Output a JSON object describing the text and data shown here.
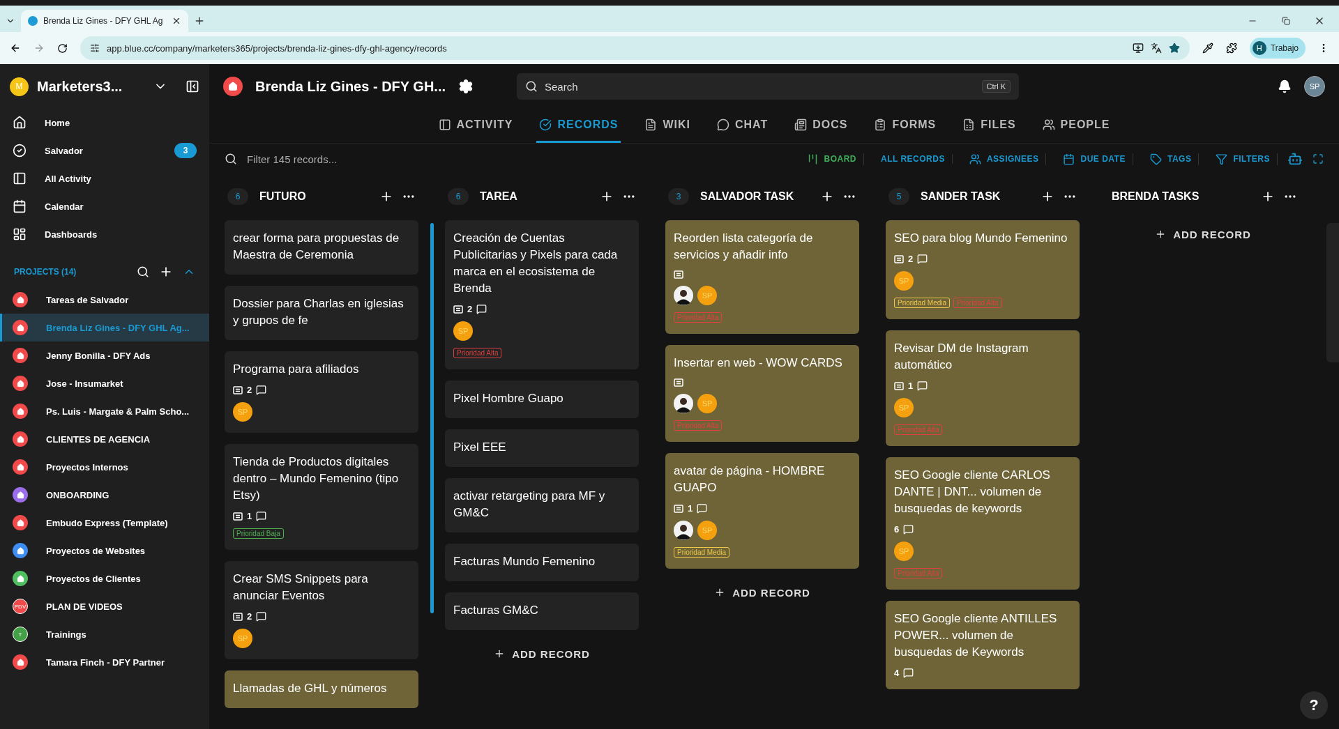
{
  "browser": {
    "tab_title": "Brenda Liz Gines - DFY GHL Ag",
    "url": "app.blue.cc/company/marketers365/projects/brenda-liz-gines-dfy-ghl-agency/records",
    "profile": {
      "initial": "H",
      "label": "Trabajo"
    }
  },
  "workspace": {
    "initial": "M",
    "name": "Marketers3..."
  },
  "nav": [
    {
      "kind": "home",
      "label": "Home"
    },
    {
      "kind": "tasks",
      "label": "Salvador",
      "badge": "3"
    },
    {
      "kind": "activity",
      "label": "All Activity"
    },
    {
      "kind": "calendar",
      "label": "Calendar"
    },
    {
      "kind": "dashboards",
      "label": "Dashboards"
    }
  ],
  "projects": {
    "title": "PROJECTS (14)",
    "expanded": true,
    "items": [
      {
        "name": "Tareas de Salvador",
        "kind": "home",
        "color": "#f04a4a",
        "selected": false
      },
      {
        "name": "Brenda Liz Gines - DFY GHL Ag...",
        "kind": "home",
        "color": "#f04a4a",
        "selected": true
      },
      {
        "name": "Jenny Bonilla - DFY Ads",
        "kind": "home",
        "color": "#f04a4a",
        "selected": false
      },
      {
        "name": "Jose - Insumarket",
        "kind": "home",
        "color": "#f04a4a",
        "selected": false
      },
      {
        "name": "Ps. Luis - Margate & Palm Scho...",
        "kind": "home",
        "color": "#f04a4a",
        "selected": false
      },
      {
        "name": "CLIENTES DE AGENCIA",
        "kind": "home",
        "color": "#f04a4a",
        "selected": false
      },
      {
        "name": "Proyectos Internos",
        "kind": "home",
        "color": "#f04a4a",
        "selected": false
      },
      {
        "name": "ONBOARDING",
        "kind": "home",
        "color": "#9a6ee8",
        "selected": false
      },
      {
        "name": "Embudo Express (Template)",
        "kind": "home",
        "color": "#f04a4a",
        "selected": false
      },
      {
        "name": "Proyectos de Websites",
        "kind": "home",
        "color": "#3d8ef0",
        "selected": false
      },
      {
        "name": "Proyectos de Clientes",
        "kind": "home",
        "color": "#4fbf5f",
        "selected": false
      },
      {
        "name": "PLAN DE VIDEOS",
        "kind": "initials",
        "initials": "PDV",
        "color": "#f04a4a",
        "selected": false
      },
      {
        "name": "Trainings",
        "kind": "initials",
        "initials": "T",
        "color": "#43a047",
        "selected": false
      },
      {
        "name": "Tamara Finch - DFY Partner",
        "kind": "home",
        "color": "#f04a4a",
        "selected": false
      }
    ]
  },
  "header": {
    "project_name": "Brenda Liz Gines - DFY GH...",
    "search_placeholder": "Search",
    "shortcut": "Ctrl K",
    "user_initials": "SP"
  },
  "tabs": [
    {
      "kind": "activity",
      "label": "ACTIVITY",
      "selected": false
    },
    {
      "kind": "records",
      "label": "RECORDS",
      "selected": true
    },
    {
      "kind": "wiki",
      "label": "WIKI",
      "selected": false
    },
    {
      "kind": "chat",
      "label": "CHAT",
      "selected": false
    },
    {
      "kind": "docs",
      "label": "DOCS",
      "selected": false
    },
    {
      "kind": "forms",
      "label": "FORMS",
      "selected": false
    },
    {
      "kind": "files",
      "label": "FILES",
      "selected": false
    },
    {
      "kind": "people",
      "label": "PEOPLE",
      "selected": false
    }
  ],
  "toolbar": {
    "filter_placeholder": "Filter 145 records...",
    "views": [
      {
        "kind": "board",
        "label": "BOARD"
      },
      {
        "kind": "all",
        "label": "ALL RECORDS"
      },
      {
        "kind": "assignees",
        "label": "ASSIGNEES"
      },
      {
        "kind": "due",
        "label": "DUE DATE"
      },
      {
        "kind": "tags",
        "label": "TAGS"
      },
      {
        "kind": "filters",
        "label": "FILTERS"
      }
    ]
  },
  "columns": [
    {
      "count": "6",
      "title": "FUTURO",
      "scrollbar": true,
      "cards": [
        {
          "title": "crear forma para propuestas de Maestra de Ceremonia",
          "color": "#232323"
        },
        {
          "title": "Dossier para Charlas en iglesias y grupos de fe",
          "color": "#232323"
        },
        {
          "title": "Programa para afiliados",
          "color": "#232323",
          "description": true,
          "comments": "2",
          "avatars": [
            {
              "kind": "initials",
              "text": "SP"
            }
          ]
        },
        {
          "title": "Tienda de Productos digitales dentro – Mundo Femenino (tipo Etsy)",
          "color": "#232323",
          "description": true,
          "comments": "1",
          "tags": [
            {
              "label": "Prioridad Baja",
              "color": "#4caf50"
            }
          ]
        },
        {
          "title": "Crear SMS Snippets para anunciar Eventos",
          "color": "#232323",
          "description": true,
          "comments": "2",
          "avatars": [
            {
              "kind": "initials",
              "text": "SP"
            }
          ]
        },
        {
          "title": "Llamadas de GHL y números",
          "color": "#6e6437"
        }
      ]
    },
    {
      "count": "6",
      "title": "TAREA",
      "add_label": "ADD RECORD",
      "cards": [
        {
          "title": "Creación de Cuentas Publicitarias y Pixels para cada marca en el ecosistema de Brenda",
          "color": "#232323",
          "description": true,
          "comments": "2",
          "avatars": [
            {
              "kind": "initials",
              "text": "SP"
            }
          ],
          "tags": [
            {
              "label": "Prioridad Alta",
              "color": "#e04040"
            }
          ]
        },
        {
          "title": "Pixel Hombre Guapo",
          "color": "#232323"
        },
        {
          "title": "Pixel EEE",
          "color": "#232323"
        },
        {
          "title": "activar retargeting para MF y GM&C",
          "color": "#232323"
        },
        {
          "title": "Facturas Mundo Femenino",
          "color": "#232323"
        },
        {
          "title": "Facturas GM&C",
          "color": "#232323"
        }
      ]
    },
    {
      "count": "3",
      "title": "SALVADOR TASK",
      "add_label": "ADD RECORD",
      "cards": [
        {
          "title": "Reorden lista categoría de servicios y añadir info",
          "color": "#6e6437",
          "description": true,
          "avatars": [
            {
              "kind": "photo"
            },
            {
              "kind": "initials",
              "text": "SP"
            }
          ],
          "tags": [
            {
              "label": "Prioridad Alta",
              "color": "#e04040"
            }
          ]
        },
        {
          "title": "Insertar en web - WOW CARDS",
          "color": "#6e6437",
          "description": true,
          "avatars": [
            {
              "kind": "photo"
            },
            {
              "kind": "initials",
              "text": "SP"
            }
          ],
          "tags": [
            {
              "label": "Prioridad Alta",
              "color": "#e04040"
            }
          ]
        },
        {
          "title": "avatar de página - HOMBRE GUAPO",
          "color": "#6e6437",
          "description": true,
          "comments": "1",
          "avatars": [
            {
              "kind": "photo"
            },
            {
              "kind": "initials",
              "text": "SP"
            }
          ],
          "tags": [
            {
              "label": "Prioridad Media",
              "color": "#f0c84a"
            }
          ]
        }
      ]
    },
    {
      "count": "5",
      "title": "SANDER TASK",
      "cards": [
        {
          "title": "SEO para blog Mundo Femenino",
          "color": "#6e6437",
          "description": true,
          "comments": "2",
          "avatars": [
            {
              "kind": "initials",
              "text": "SP"
            }
          ],
          "tags": [
            {
              "label": "Prioridad Media",
              "color": "#f0c84a"
            },
            {
              "label": "Prioridad Alta",
              "color": "#e04040"
            }
          ]
        },
        {
          "title": "Revisar DM de Instagram automático",
          "color": "#6e6437",
          "description": true,
          "comments": "1",
          "avatars": [
            {
              "kind": "initials",
              "text": "SP"
            }
          ],
          "tags": [
            {
              "label": "Prioridad Alta",
              "color": "#e04040"
            }
          ]
        },
        {
          "title": "SEO Google cliente CARLOS DANTE | DNT... volumen de busquedas de keywords",
          "color": "#6e6437",
          "comments": "6",
          "avatars": [
            {
              "kind": "initials",
              "text": "SP"
            }
          ],
          "tags": [
            {
              "label": "Prioridad Alta",
              "color": "#e04040"
            }
          ]
        },
        {
          "title": "SEO Google cliente ANTILLES POWER... volumen de busquedas de Keywords",
          "color": "#6e6437",
          "comments": "4"
        }
      ]
    },
    {
      "title": "BRENDA TASKS",
      "add_label": "ADD RECORD"
    }
  ],
  "help": "?"
}
